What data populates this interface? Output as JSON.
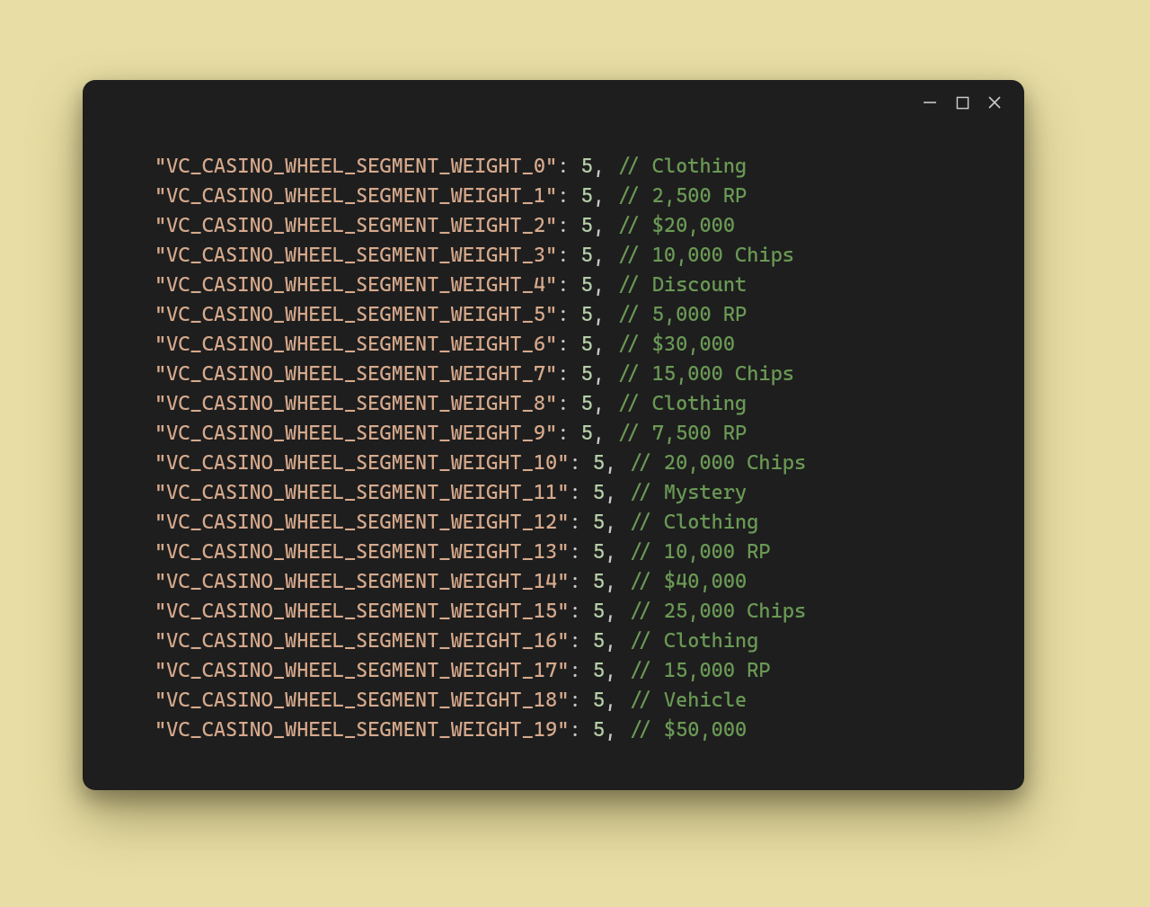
{
  "colors": {
    "page_bg": "#e8dea5",
    "window_bg": "#1e1e1e",
    "string": "#d6a98c",
    "punct": "#c9c9c9",
    "number": "#b5cea8",
    "comment": "#6a9955"
  },
  "code_lines": [
    {
      "key": "\"VC_CASINO_WHEEL_SEGMENT_WEIGHT_0\"",
      "sep": ": ",
      "value": "5",
      "tail": ", ",
      "comment": "// Clothing"
    },
    {
      "key": "\"VC_CASINO_WHEEL_SEGMENT_WEIGHT_1\"",
      "sep": ": ",
      "value": "5",
      "tail": ", ",
      "comment": "// 2,500 RP"
    },
    {
      "key": "\"VC_CASINO_WHEEL_SEGMENT_WEIGHT_2\"",
      "sep": ": ",
      "value": "5",
      "tail": ", ",
      "comment": "// $20,000"
    },
    {
      "key": "\"VC_CASINO_WHEEL_SEGMENT_WEIGHT_3\"",
      "sep": ": ",
      "value": "5",
      "tail": ", ",
      "comment": "// 10,000 Chips"
    },
    {
      "key": "\"VC_CASINO_WHEEL_SEGMENT_WEIGHT_4\"",
      "sep": ": ",
      "value": "5",
      "tail": ", ",
      "comment": "// Discount"
    },
    {
      "key": "\"VC_CASINO_WHEEL_SEGMENT_WEIGHT_5\"",
      "sep": ": ",
      "value": "5",
      "tail": ", ",
      "comment": "// 5,000 RP"
    },
    {
      "key": "\"VC_CASINO_WHEEL_SEGMENT_WEIGHT_6\"",
      "sep": ": ",
      "value": "5",
      "tail": ", ",
      "comment": "// $30,000"
    },
    {
      "key": "\"VC_CASINO_WHEEL_SEGMENT_WEIGHT_7\"",
      "sep": ": ",
      "value": "5",
      "tail": ", ",
      "comment": "// 15,000 Chips"
    },
    {
      "key": "\"VC_CASINO_WHEEL_SEGMENT_WEIGHT_8\"",
      "sep": ": ",
      "value": "5",
      "tail": ", ",
      "comment": "// Clothing"
    },
    {
      "key": "\"VC_CASINO_WHEEL_SEGMENT_WEIGHT_9\"",
      "sep": ": ",
      "value": "5",
      "tail": ", ",
      "comment": "// 7,500 RP"
    },
    {
      "key": "\"VC_CASINO_WHEEL_SEGMENT_WEIGHT_10\"",
      "sep": ": ",
      "value": "5",
      "tail": ", ",
      "comment": "// 20,000 Chips"
    },
    {
      "key": "\"VC_CASINO_WHEEL_SEGMENT_WEIGHT_11\"",
      "sep": ": ",
      "value": "5",
      "tail": ", ",
      "comment": "// Mystery"
    },
    {
      "key": "\"VC_CASINO_WHEEL_SEGMENT_WEIGHT_12\"",
      "sep": ": ",
      "value": "5",
      "tail": ", ",
      "comment": "// Clothing"
    },
    {
      "key": "\"VC_CASINO_WHEEL_SEGMENT_WEIGHT_13\"",
      "sep": ": ",
      "value": "5",
      "tail": ", ",
      "comment": "// 10,000 RP"
    },
    {
      "key": "\"VC_CASINO_WHEEL_SEGMENT_WEIGHT_14\"",
      "sep": ": ",
      "value": "5",
      "tail": ", ",
      "comment": "// $40,000"
    },
    {
      "key": "\"VC_CASINO_WHEEL_SEGMENT_WEIGHT_15\"",
      "sep": ": ",
      "value": "5",
      "tail": ", ",
      "comment": "// 25,000 Chips"
    },
    {
      "key": "\"VC_CASINO_WHEEL_SEGMENT_WEIGHT_16\"",
      "sep": ": ",
      "value": "5",
      "tail": ", ",
      "comment": "// Clothing"
    },
    {
      "key": "\"VC_CASINO_WHEEL_SEGMENT_WEIGHT_17\"",
      "sep": ": ",
      "value": "5",
      "tail": ", ",
      "comment": "// 15,000 RP"
    },
    {
      "key": "\"VC_CASINO_WHEEL_SEGMENT_WEIGHT_18\"",
      "sep": ": ",
      "value": "5",
      "tail": ", ",
      "comment": "// Vehicle"
    },
    {
      "key": "\"VC_CASINO_WHEEL_SEGMENT_WEIGHT_19\"",
      "sep": ": ",
      "value": "5",
      "tail": ", ",
      "comment": "// $50,000"
    }
  ]
}
